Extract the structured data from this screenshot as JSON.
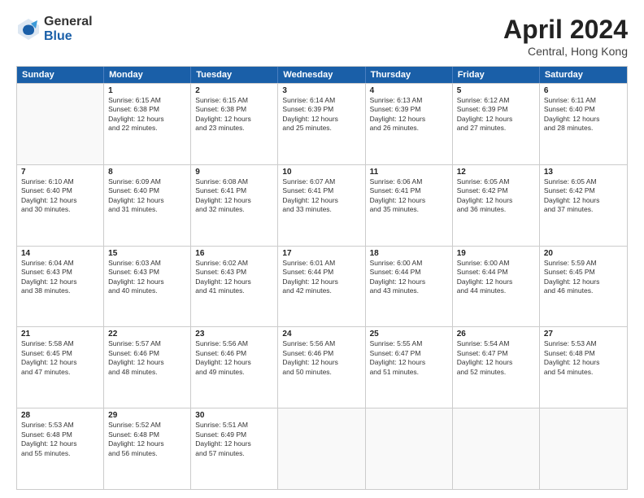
{
  "header": {
    "logo_general": "General",
    "logo_blue": "Blue",
    "month_title": "April 2024",
    "location": "Central, Hong Kong"
  },
  "days_of_week": [
    "Sunday",
    "Monday",
    "Tuesday",
    "Wednesday",
    "Thursday",
    "Friday",
    "Saturday"
  ],
  "weeks": [
    [
      {
        "day": "",
        "info": ""
      },
      {
        "day": "1",
        "info": "Sunrise: 6:15 AM\nSunset: 6:38 PM\nDaylight: 12 hours\nand 22 minutes."
      },
      {
        "day": "2",
        "info": "Sunrise: 6:15 AM\nSunset: 6:38 PM\nDaylight: 12 hours\nand 23 minutes."
      },
      {
        "day": "3",
        "info": "Sunrise: 6:14 AM\nSunset: 6:39 PM\nDaylight: 12 hours\nand 25 minutes."
      },
      {
        "day": "4",
        "info": "Sunrise: 6:13 AM\nSunset: 6:39 PM\nDaylight: 12 hours\nand 26 minutes."
      },
      {
        "day": "5",
        "info": "Sunrise: 6:12 AM\nSunset: 6:39 PM\nDaylight: 12 hours\nand 27 minutes."
      },
      {
        "day": "6",
        "info": "Sunrise: 6:11 AM\nSunset: 6:40 PM\nDaylight: 12 hours\nand 28 minutes."
      }
    ],
    [
      {
        "day": "7",
        "info": "Sunrise: 6:10 AM\nSunset: 6:40 PM\nDaylight: 12 hours\nand 30 minutes."
      },
      {
        "day": "8",
        "info": "Sunrise: 6:09 AM\nSunset: 6:40 PM\nDaylight: 12 hours\nand 31 minutes."
      },
      {
        "day": "9",
        "info": "Sunrise: 6:08 AM\nSunset: 6:41 PM\nDaylight: 12 hours\nand 32 minutes."
      },
      {
        "day": "10",
        "info": "Sunrise: 6:07 AM\nSunset: 6:41 PM\nDaylight: 12 hours\nand 33 minutes."
      },
      {
        "day": "11",
        "info": "Sunrise: 6:06 AM\nSunset: 6:41 PM\nDaylight: 12 hours\nand 35 minutes."
      },
      {
        "day": "12",
        "info": "Sunrise: 6:05 AM\nSunset: 6:42 PM\nDaylight: 12 hours\nand 36 minutes."
      },
      {
        "day": "13",
        "info": "Sunrise: 6:05 AM\nSunset: 6:42 PM\nDaylight: 12 hours\nand 37 minutes."
      }
    ],
    [
      {
        "day": "14",
        "info": "Sunrise: 6:04 AM\nSunset: 6:43 PM\nDaylight: 12 hours\nand 38 minutes."
      },
      {
        "day": "15",
        "info": "Sunrise: 6:03 AM\nSunset: 6:43 PM\nDaylight: 12 hours\nand 40 minutes."
      },
      {
        "day": "16",
        "info": "Sunrise: 6:02 AM\nSunset: 6:43 PM\nDaylight: 12 hours\nand 41 minutes."
      },
      {
        "day": "17",
        "info": "Sunrise: 6:01 AM\nSunset: 6:44 PM\nDaylight: 12 hours\nand 42 minutes."
      },
      {
        "day": "18",
        "info": "Sunrise: 6:00 AM\nSunset: 6:44 PM\nDaylight: 12 hours\nand 43 minutes."
      },
      {
        "day": "19",
        "info": "Sunrise: 6:00 AM\nSunset: 6:44 PM\nDaylight: 12 hours\nand 44 minutes."
      },
      {
        "day": "20",
        "info": "Sunrise: 5:59 AM\nSunset: 6:45 PM\nDaylight: 12 hours\nand 46 minutes."
      }
    ],
    [
      {
        "day": "21",
        "info": "Sunrise: 5:58 AM\nSunset: 6:45 PM\nDaylight: 12 hours\nand 47 minutes."
      },
      {
        "day": "22",
        "info": "Sunrise: 5:57 AM\nSunset: 6:46 PM\nDaylight: 12 hours\nand 48 minutes."
      },
      {
        "day": "23",
        "info": "Sunrise: 5:56 AM\nSunset: 6:46 PM\nDaylight: 12 hours\nand 49 minutes."
      },
      {
        "day": "24",
        "info": "Sunrise: 5:56 AM\nSunset: 6:46 PM\nDaylight: 12 hours\nand 50 minutes."
      },
      {
        "day": "25",
        "info": "Sunrise: 5:55 AM\nSunset: 6:47 PM\nDaylight: 12 hours\nand 51 minutes."
      },
      {
        "day": "26",
        "info": "Sunrise: 5:54 AM\nSunset: 6:47 PM\nDaylight: 12 hours\nand 52 minutes."
      },
      {
        "day": "27",
        "info": "Sunrise: 5:53 AM\nSunset: 6:48 PM\nDaylight: 12 hours\nand 54 minutes."
      }
    ],
    [
      {
        "day": "28",
        "info": "Sunrise: 5:53 AM\nSunset: 6:48 PM\nDaylight: 12 hours\nand 55 minutes."
      },
      {
        "day": "29",
        "info": "Sunrise: 5:52 AM\nSunset: 6:48 PM\nDaylight: 12 hours\nand 56 minutes."
      },
      {
        "day": "30",
        "info": "Sunrise: 5:51 AM\nSunset: 6:49 PM\nDaylight: 12 hours\nand 57 minutes."
      },
      {
        "day": "",
        "info": ""
      },
      {
        "day": "",
        "info": ""
      },
      {
        "day": "",
        "info": ""
      },
      {
        "day": "",
        "info": ""
      }
    ]
  ]
}
